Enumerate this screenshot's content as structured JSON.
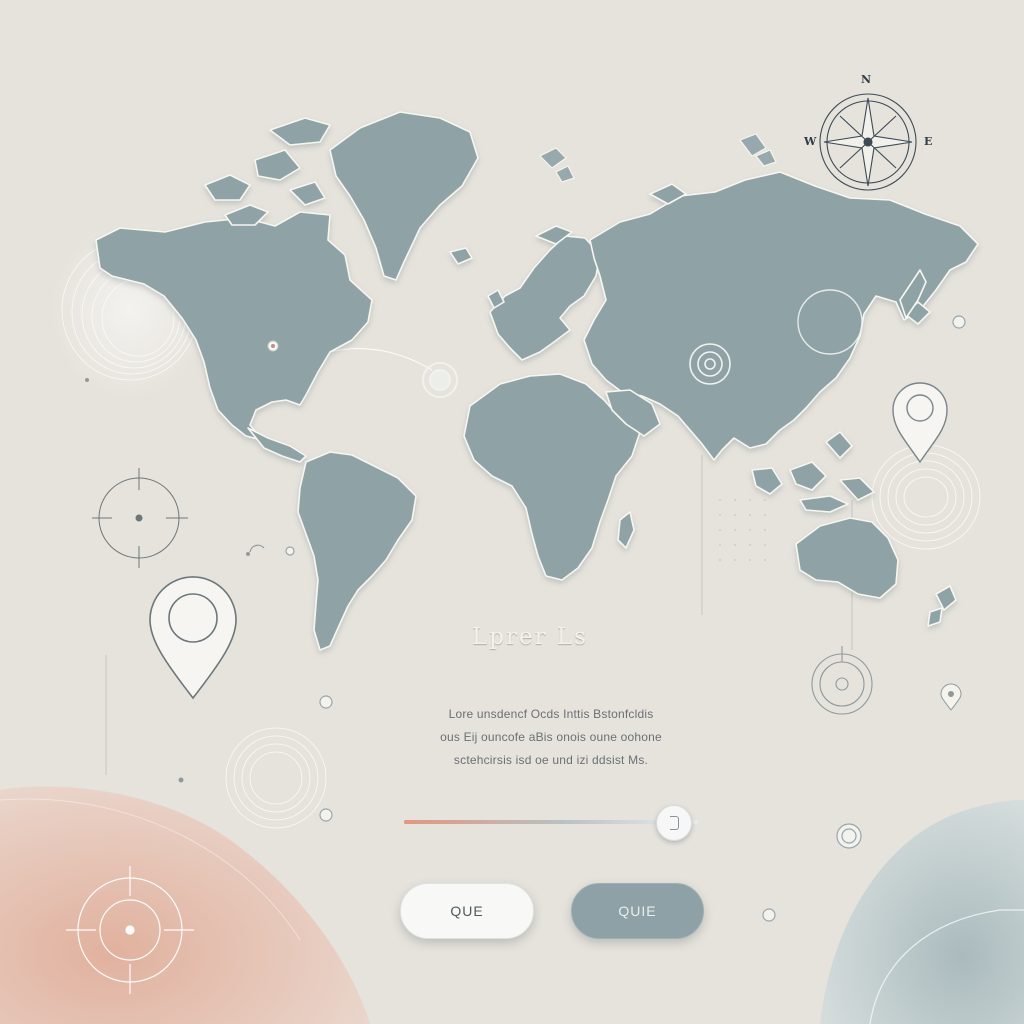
{
  "hero": {
    "title": "Lprer Ls",
    "body_lines": [
      "Lore unsdencf Ocds Inttis Bstonfcldis",
      "ous Eij ouncofe aBis onois oune oohone",
      "sctehcirsis isd oe und izi ddsist Ms."
    ]
  },
  "compass": {
    "north_label": "N",
    "west_label": "W",
    "east_label": "E"
  },
  "slider": {
    "value_percent": 92
  },
  "buttons": {
    "primary_label": "QUE",
    "secondary_label": "QUIE"
  },
  "colors": {
    "background": "#e6e3dc",
    "land": "#8fa3a7",
    "land_outline": "#f7f6f1",
    "accent_warm": "#e29682",
    "accent_cool": "#9fb2b6"
  },
  "icons": [
    "compass-rose-icon",
    "map-pin-icon",
    "crosshair-icon",
    "location-dot-icon",
    "target-ring-icon"
  ]
}
